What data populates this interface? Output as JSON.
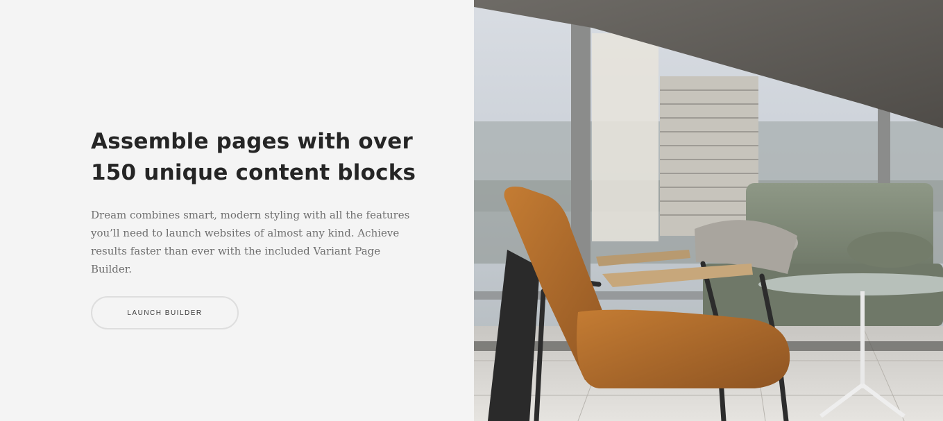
{
  "hero": {
    "heading_line1": "Assemble pages with over",
    "heading_line2": "150 unique content blocks",
    "body": "Dream combines smart, modern styling with all the features you’ll need to launch websites of almost any kind. Achieve results faster than ever with the included Variant Page Builder.",
    "cta_label": "LAUNCH BUILDER"
  },
  "photo": {
    "subject": "lounge-chair-interior-photo"
  },
  "colors": {
    "background": "#f4f4f4",
    "heading": "#252525",
    "body": "#6f6f6f",
    "button_border": "#dedede",
    "chair": "#b06a2c",
    "sofa": "#7f8a78"
  }
}
